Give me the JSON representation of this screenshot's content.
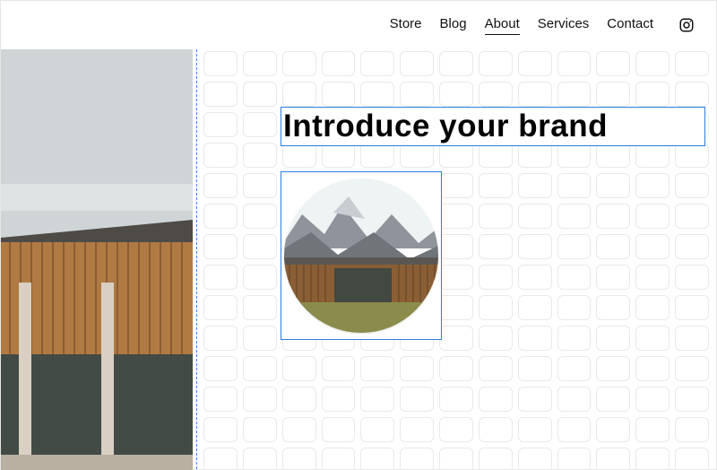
{
  "nav": {
    "items": [
      {
        "label": "Store",
        "active": false
      },
      {
        "label": "Blog",
        "active": false
      },
      {
        "label": "About",
        "active": true
      },
      {
        "label": "Services",
        "active": false
      },
      {
        "label": "Contact",
        "active": false
      }
    ],
    "social_icon": "instagram-icon"
  },
  "editor": {
    "heading_text": "Introduce your brand",
    "image_shape": "circle",
    "guide_color": "#3b82f6",
    "selection_color": "#2f7de1"
  }
}
